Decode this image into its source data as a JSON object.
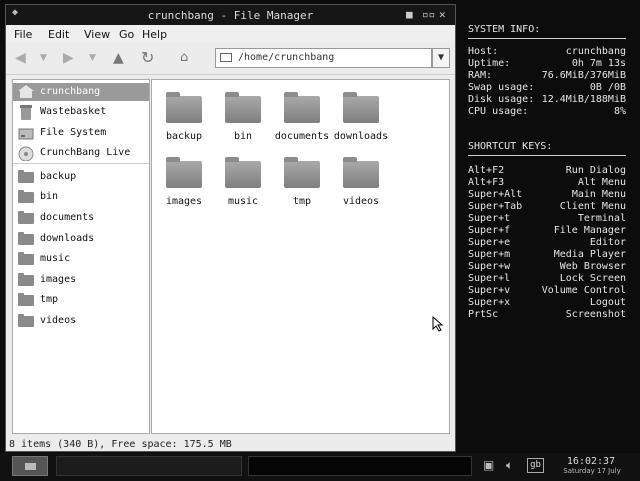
{
  "window": {
    "title": "crunchbang - File Manager",
    "menu": [
      "File",
      "Edit",
      "View",
      "Go",
      "Help"
    ],
    "path": "/home/crunchbang",
    "controls": {
      "left": "◆",
      "minimize": "✕",
      "maximize": "◦◦",
      "close": "✕✕"
    }
  },
  "sidebar": {
    "places": [
      {
        "label": "crunchbang",
        "icon": "home-icon"
      },
      {
        "label": "Wastebasket",
        "icon": "trash-icon"
      },
      {
        "label": "File System",
        "icon": "drive-icon"
      },
      {
        "label": "CrunchBang Live",
        "icon": "disc-icon"
      }
    ],
    "bookmarks": [
      "backup",
      "bin",
      "documents",
      "downloads",
      "music",
      "images",
      "tmp",
      "videos"
    ]
  },
  "files": [
    "backup",
    "bin",
    "documents",
    "downloads",
    "images",
    "music",
    "tmp",
    "videos"
  ],
  "status": "8 items (340 B), Free space: 175.5 MB",
  "conky": {
    "system_header": "SYSTEM INFO:",
    "system": [
      {
        "k": "Host:",
        "v": "crunchbang"
      },
      {
        "k": "Uptime:",
        "v": "0h 7m 13s"
      },
      {
        "k": "RAM:",
        "v": "76.6MiB/376MiB"
      },
      {
        "k": "Swap usage:",
        "v": "0B  /0B"
      },
      {
        "k": "Disk usage:",
        "v": "12.4MiB/188MiB"
      },
      {
        "k": "CPU usage:",
        "v": "8%"
      }
    ],
    "shortcut_header": "SHORTCUT KEYS:",
    "shortcuts": [
      {
        "k": "Alt+F2",
        "v": "Run Dialog"
      },
      {
        "k": "Alt+F3",
        "v": "Alt Menu"
      },
      {
        "k": "Super+Alt",
        "v": "Main Menu"
      },
      {
        "k": "Super+Tab",
        "v": "Client Menu"
      },
      {
        "k": "Super+t",
        "v": "Terminal"
      },
      {
        "k": "Super+f",
        "v": "File Manager"
      },
      {
        "k": "Super+e",
        "v": "Editor"
      },
      {
        "k": "Super+m",
        "v": "Media Player"
      },
      {
        "k": "Super+w",
        "v": "Web Browser"
      },
      {
        "k": "Super+l",
        "v": "Lock Screen"
      },
      {
        "k": "Super+v",
        "v": "Volume Control"
      },
      {
        "k": "Super+x",
        "v": "Logout"
      },
      {
        "k": "PrtSc",
        "v": "Screenshot"
      }
    ]
  },
  "panel": {
    "keyboard_layout": "gb",
    "time": "16:02:37",
    "date": "Saturday 17 July"
  }
}
